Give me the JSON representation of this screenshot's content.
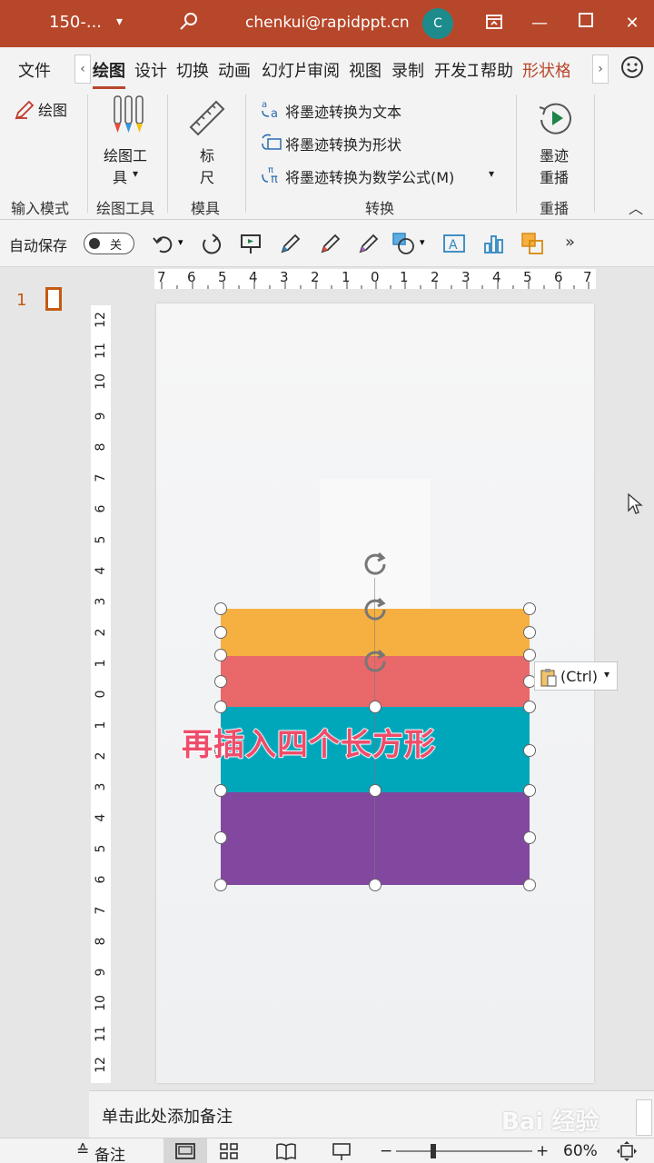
{
  "titlebar": {
    "filename": "150-...",
    "email": "chenkui@rapidppt.cn",
    "avatar_letter": "C"
  },
  "tabs": [
    "文件",
    "绘图",
    "设计",
    "切换",
    "动画",
    "幻灯片",
    "审阅",
    "视图",
    "录制",
    "开发工",
    "帮助",
    "形状格"
  ],
  "ribbon": {
    "draw_label": "绘图",
    "input_mode": "输入模式",
    "draw_tools_btn_1": "绘图工",
    "draw_tools_btn_2": "具",
    "draw_tools_group": "绘图工具",
    "ruler_1": "标",
    "ruler_2": "尺",
    "stencils_group": "模具",
    "convert_text": "将墨迹转换为文本",
    "convert_shape": "将墨迹转换为形状",
    "convert_math": "将墨迹转换为数学公式(M)",
    "convert_group": "转换",
    "replay_1": "墨迹",
    "replay_2": "重播",
    "replay_group": "重播"
  },
  "qat": {
    "autosave": "自动保存",
    "toggle": "关"
  },
  "slide_panel": {
    "number": "1"
  },
  "ruler": {
    "h": [
      "7",
      "6",
      "5",
      "4",
      "3",
      "2",
      "1",
      "0",
      "1",
      "2",
      "3",
      "4",
      "5",
      "6",
      "7"
    ],
    "v": [
      "12",
      "11",
      "10",
      "9",
      "8",
      "7",
      "6",
      "5",
      "4",
      "3",
      "2",
      "1",
      "0",
      "1",
      "2",
      "3",
      "4",
      "5",
      "6",
      "7",
      "8",
      "9",
      "10",
      "11",
      "12"
    ]
  },
  "shapes": {
    "colors": [
      "#f5b041",
      "#e9686a",
      "#00a6ba",
      "#8248a0"
    ]
  },
  "caption": "再插入四个长方形",
  "paste": {
    "label": "(Ctrl)"
  },
  "notes": {
    "placeholder": "单击此处添加备注"
  },
  "status": {
    "notes": "备注",
    "zoom": "60%"
  },
  "watermark": "Bai 经验"
}
